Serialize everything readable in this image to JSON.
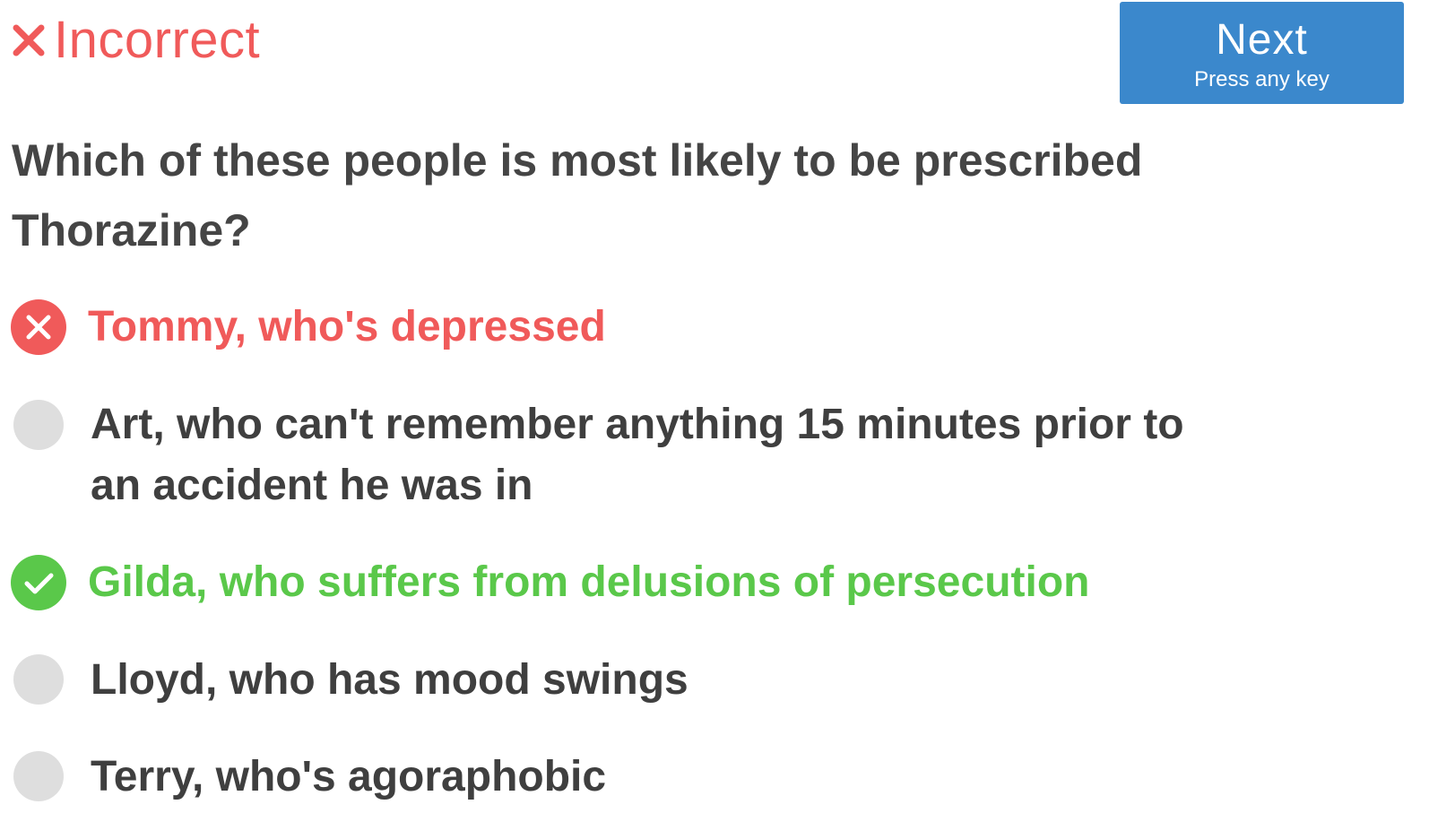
{
  "result": {
    "icon": "close-icon",
    "label": "Incorrect",
    "color": "#f05a5a"
  },
  "next_button": {
    "label": "Next",
    "hint": "Press any key",
    "color": "#3b88cc"
  },
  "question": {
    "text": "Which of these people is most likely to be prescribed Thorazine?"
  },
  "options": [
    {
      "text": "Tommy, who's depressed",
      "state": "selected-incorrect",
      "icon": "x-circle-icon"
    },
    {
      "text": "Art, who can't remember anything 15 minutes prior to an accident he was in",
      "state": "unselected",
      "icon": "empty-circle-icon"
    },
    {
      "text": "Gilda, who suffers from delusions of persecution",
      "state": "correct",
      "icon": "check-circle-icon"
    },
    {
      "text": "Lloyd, who has mood swings",
      "state": "unselected",
      "icon": "empty-circle-icon"
    },
    {
      "text": "Terry, who's agoraphobic",
      "state": "unselected",
      "icon": "empty-circle-icon"
    }
  ],
  "colors": {
    "incorrect": "#f05a5a",
    "correct": "#5ac84a",
    "neutral_marker": "#dedede",
    "text": "#454545"
  }
}
